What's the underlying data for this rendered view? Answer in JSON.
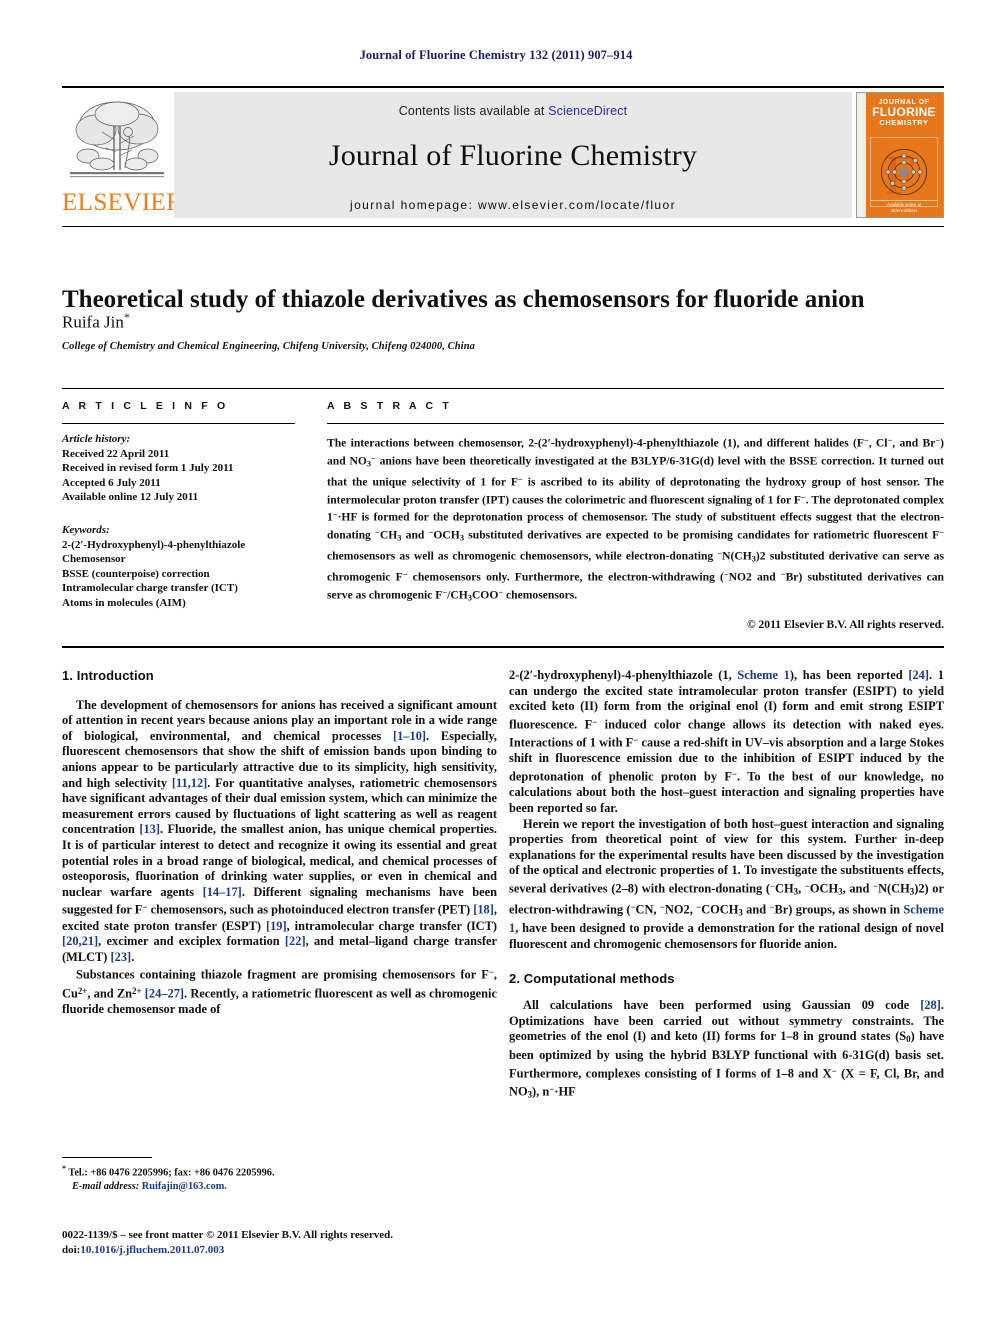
{
  "running_head": "Journal of Fluorine Chemistry 132 (2011) 907–914",
  "masthead": {
    "publisher_name": "ELSEVIER",
    "contents_prefix": "Contents lists available at ",
    "sciencedirect_link": "ScienceDirect",
    "journal_title": "Journal of Fluorine Chemistry",
    "homepage_line": "journal homepage: www.elsevier.com/locate/fluor",
    "cover": {
      "line1": "JOURNAL OF",
      "line2": "FLUORINE",
      "line3": "CHEMISTRY",
      "footer1": "Available online at",
      "footer2": "ScienceDirect"
    }
  },
  "article": {
    "title": "Theoretical study of thiazole derivatives as chemosensors for fluoride anion",
    "author": "Ruifa Jin",
    "author_marker": "*",
    "affiliation": "College of Chemistry and Chemical Engineering, Chifeng University, Chifeng 024000, China"
  },
  "article_info": {
    "heading": "A R T I C L E   I N F O",
    "history_label": "Article history:",
    "history": [
      "Received 22 April 2011",
      "Received in revised form 1 July 2011",
      "Accepted 6 July 2011",
      "Available online 12 July 2011"
    ],
    "keywords_label": "Keywords:",
    "keywords": [
      "2-(2′-Hydroxyphenyl)-4-phenylthiazole",
      "Chemosensor",
      "BSSE (counterpoise) correction",
      "Intramolecular charge transfer (ICT)",
      "Atoms in molecules (AIM)"
    ]
  },
  "abstract": {
    "heading": "A B S T R A C T",
    "text_parts": [
      "The interactions between chemosensor, 2-(2′-hydroxyphenyl)-4-phenylthiazole (1), and different halides (F−, Cl−, and Br−) and NO3− anions have been theoretically investigated at the B3LYP/6-31G(d) level with the BSSE correction. It turned out that the unique selectivity of 1 for F− is ascribed to its ability of deprotonating the hydroxy group of host sensor. The intermolecular proton transfer (IPT) causes the colorimetric and fluorescent signaling of 1 for F−. The deprotonated complex 1−·HF is formed for the deprotonation process of chemosensor. The study of substituent effects suggest that the electron-donating −CH3 and −OCH3 substituted derivatives are expected to be promising candidates for ratiometric fluorescent F− chemosensors as well as chromogenic chemosensors, while electron-donating −N(CH3)2 substituted derivative can serve as chromogenic F− chemosensors only. Furthermore, the electron-withdrawing (−NO2 and −Br) substituted derivatives can serve as chromogenic F−/CH3COO− chemosensors."
    ],
    "copyright": "© 2011 Elsevier B.V. All rights reserved."
  },
  "body": {
    "left": {
      "section_heading": "1. Introduction",
      "paragraphs": [
        "The development of chemosensors for anions has received a significant amount of attention in recent years because anions play an important role in a wide range of biological, environmental, and chemical processes [1–10]. Especially, fluorescent chemosensors that show the shift of emission bands upon binding to anions appear to be particularly attractive due to its simplicity, high sensitivity, and high selectivity [11,12]. For quantitative analyses, ratiometric chemosensors have significant advantages of their dual emission system, which can minimize the measurement errors caused by fluctuations of light scattering as well as reagent concentration [13]. Fluoride, the smallest anion, has unique chemical properties. It is of particular interest to detect and recognize it owing its essential and great potential roles in a broad range of biological, medical, and chemical processes of osteoporosis, fluorination of drinking water supplies, or even in chemical and nuclear warfare agents [14–17]. Different signaling mechanisms have been suggested for F− chemosensors, such as photoinduced electron transfer (PET) [18], excited state proton transfer (ESPT) [19], intramolecular charge transfer (ICT) [20,21], excimer and exciplex formation [22], and metal–ligand charge transfer (MLCT) [23].",
        "Substances containing thiazole fragment are promising chemosensors for F−, Cu2+, and Zn2+ [24–27]. Recently, a ratiometric fluorescent as well as chromogenic fluoride chemosensor made of"
      ]
    },
    "right": {
      "paragraphs": [
        "2-(2′-hydroxyphenyl)-4-phenylthiazole (1, Scheme 1), has been reported [24]. 1 can undergo the excited state intramolecular proton transfer (ESIPT) to yield excited keto (II) form from the original enol (I) form and emit strong ESIPT fluorescence. F− induced color change allows its detection with naked eyes. Interactions of 1 with F− cause a red-shift in UV–vis absorption and a large Stokes shift in fluorescence emission due to the inhibition of ESIPT induced by the deprotonation of phenolic proton by F−. To the best of our knowledge, no calculations about both the host–guest interaction and signaling properties have been reported so far.",
        "Herein we report the investigation of both host–guest interaction and signaling properties from theoretical point of view for this system. Further in-deep explanations for the experimental results have been discussed by the investigation of the optical and electronic properties of 1. To investigate the substituents effects, several derivatives (2–8) with electron-donating (−CH3, −OCH3, and −N(CH3)2) or electron-withdrawing (−CN, −NO2, −COCH3 and −Br) groups, as shown in Scheme 1, have been designed to provide a demonstration for the rational design of novel fluorescent and chromogenic chemosensors for fluoride anion."
      ],
      "section_heading": "2. Computational methods",
      "paragraphs2": [
        "All calculations have been performed using Gaussian 09 code [28]. Optimizations have been carried out without symmetry constraints. The geometries of the enol (I) and keto (II) forms for 1–8 in ground states (S0) have been optimized by using the hybrid B3LYP functional with 6-31G(d) basis set. Furthermore, complexes consisting of I forms of 1–8 and X− (X = F, Cl, Br, and NO3), n−·HF"
      ]
    }
  },
  "footnote": {
    "marker": "*",
    "tel_line": "Tel.: +86 0476 2205996; fax: +86 0476 2205996.",
    "email_label": "E-mail address:",
    "email": "Ruifajin@163.com."
  },
  "imprint": {
    "line1": "0022-1139/$ – see front matter © 2011 Elsevier B.V. All rights reserved.",
    "doi_label": "doi:",
    "doi": "10.1016/j.jfluchem.2011.07.003"
  },
  "colors": {
    "running_head": "#1b1b6e",
    "link": "#1b3a8c",
    "sciencedirect": "#2c2cae",
    "elsevier_orange": "#F07F1A",
    "cover_orange": "#E8761A"
  }
}
